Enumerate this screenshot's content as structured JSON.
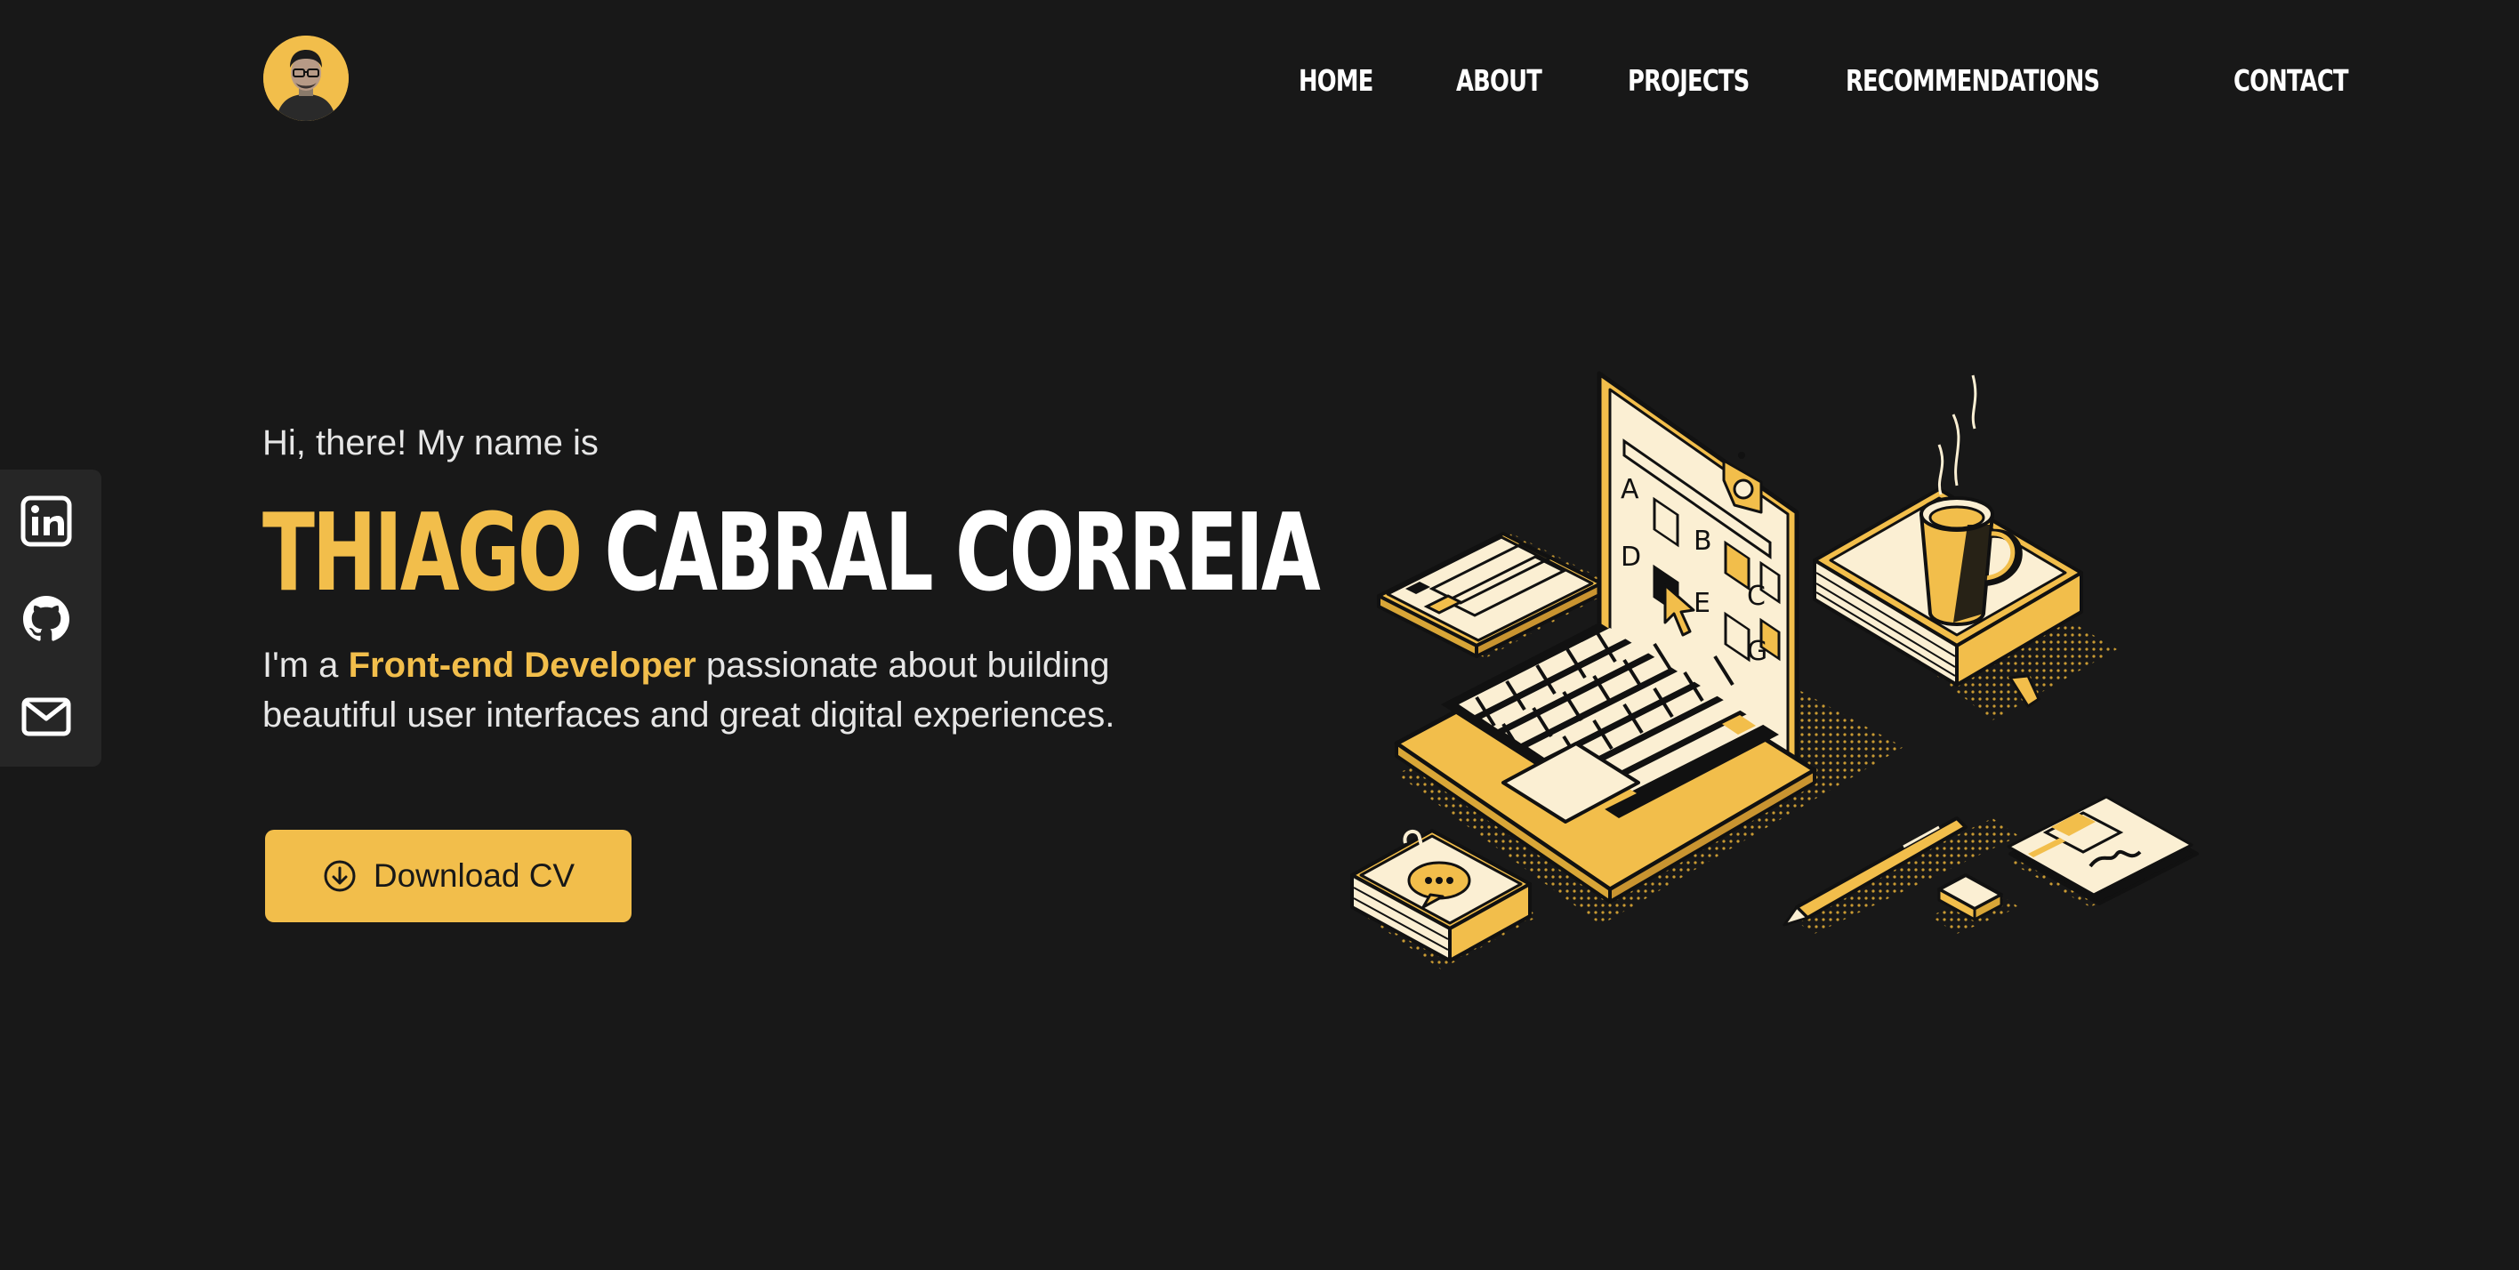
{
  "header": {
    "avatar_icon": "profile-photo",
    "nav": [
      {
        "label": "HOME"
      },
      {
        "label": "ABOUT"
      },
      {
        "label": "PROJECTS"
      },
      {
        "label": "RECOMMENDATIONS"
      },
      {
        "label": "CONTACT"
      }
    ]
  },
  "social": [
    {
      "icon": "linkedin-icon"
    },
    {
      "icon": "github-icon"
    },
    {
      "icon": "mail-icon"
    }
  ],
  "hero": {
    "greeting": "Hi, there! My name is",
    "name_first": "THIAGO",
    "name_rest": "CABRAL CORREIA",
    "tagline_prefix": "I'm a",
    "tagline_highlight": "Front-end Developer",
    "tagline_suffix": "passionate about building beautiful user interfaces and great digital experiences.",
    "download_label": "Download CV"
  },
  "illustration": {
    "screen_letters": [
      "A",
      "B",
      "C",
      "D",
      "E",
      "G"
    ]
  },
  "colors": {
    "accent": "#F2BE4B",
    "background": "#181818",
    "panel": "#262626",
    "text": "#FFFFFF",
    "cream": "#FBEFD3"
  }
}
